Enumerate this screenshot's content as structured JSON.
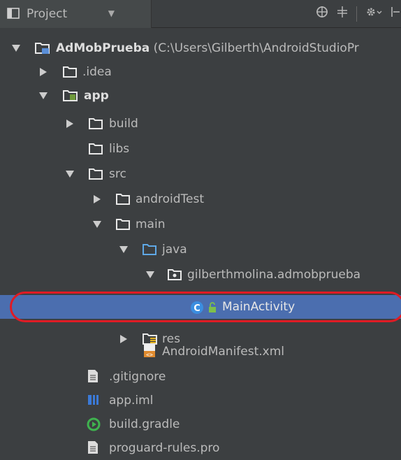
{
  "toolbar": {
    "view_label": "Project",
    "icons": [
      "project-view-icon",
      "chevron-down-icon",
      "sync-icon",
      "collapse-all-icon",
      "gear-icon",
      "hide-icon"
    ]
  },
  "tree": [
    {
      "label": "AdMobPrueba",
      "path": "(C:\\Users\\Gilberth\\AndroidStudioPr",
      "icon": "project-folder-icon"
    },
    {
      "label": ".idea",
      "icon": "folder-icon"
    },
    {
      "label": "app",
      "icon": "module-folder-icon"
    },
    {
      "label": "build",
      "icon": "folder-icon"
    },
    {
      "label": "libs",
      "icon": "folder-icon"
    },
    {
      "label": "src",
      "icon": "folder-icon"
    },
    {
      "label": "androidTest",
      "icon": "folder-icon"
    },
    {
      "label": "main",
      "icon": "folder-icon"
    },
    {
      "label": "java",
      "icon": "source-folder-icon"
    },
    {
      "label": "gilberthmolina.admobprueba",
      "icon": "package-icon"
    },
    {
      "label": "MainActivity",
      "icon": "class-icon",
      "selected": true
    },
    {
      "label": "res",
      "icon": "resource-folder-icon"
    },
    {
      "label": "AndroidManifest.xml",
      "icon": "manifest-icon"
    },
    {
      "label": ".gitignore",
      "icon": "text-file-icon"
    },
    {
      "label": "app.iml",
      "icon": "iml-file-icon"
    },
    {
      "label": "build.gradle",
      "icon": "gradle-icon"
    },
    {
      "label": "proguard-rules.pro",
      "icon": "text-file-icon"
    }
  ],
  "colors": {
    "background": "#3c3f41",
    "selection": "#4b6eaf",
    "folder": "#e8e8e8",
    "highlight_ring": "#e01b24"
  }
}
